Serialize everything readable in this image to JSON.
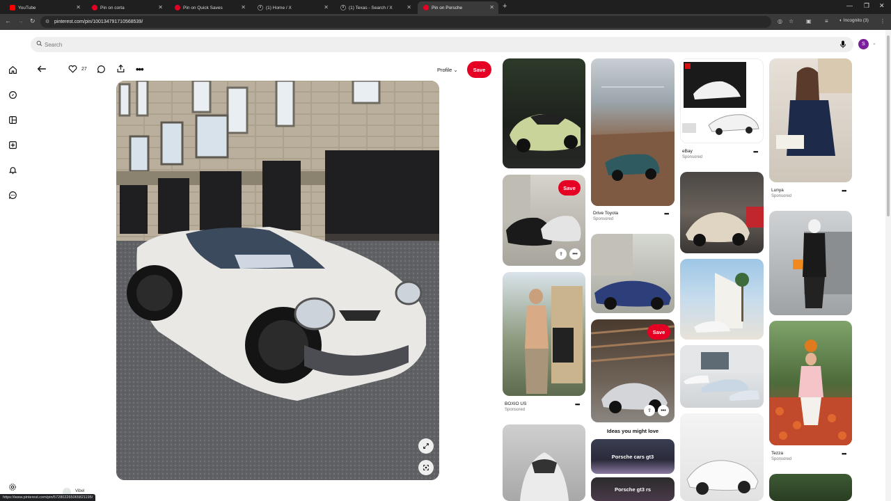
{
  "browser": {
    "tabs": [
      {
        "label": "YouTube",
        "favicon": "youtube-icon"
      },
      {
        "label": "Pin on corta",
        "favicon": "pinterest-icon"
      },
      {
        "label": "Pin on Quick Saves",
        "favicon": "pinterest-icon"
      },
      {
        "label": "(1) Home / X",
        "favicon": "x-icon"
      },
      {
        "label": "(1) Texas - Search / X",
        "favicon": "x-icon"
      },
      {
        "label": "Pin on Porsche",
        "favicon": "pinterest-icon",
        "active": true
      }
    ],
    "url": "pinterest.com/pin/100134791710568539/",
    "incognito_label": "Incognito (3)",
    "status_url": "https://www.pinterest.com/pin/572802265065821195/"
  },
  "app": {
    "brand_color": "#e60023",
    "search_placeholder": "Search",
    "avatar_letter": "S"
  },
  "pin": {
    "like_count": "27",
    "profile_label": "Profile",
    "save_label": "Save"
  },
  "feed": {
    "card_save_label": "Save",
    "cards": [
      {
        "title": "Drive Toyota",
        "subtitle": "Sponsored"
      },
      {
        "title": "eBay",
        "subtitle": "Sponsored"
      },
      {
        "title": "Lunya",
        "subtitle": "Sponsored"
      },
      {
        "title": "BOXIO US",
        "subtitle": "Sponsored"
      },
      {
        "title": "Tezza",
        "subtitle": "Sponsored"
      }
    ],
    "ideas_heading": "Ideas you might love",
    "ideas": [
      "Porsche cars gt3",
      "Porsche gt3 rs"
    ],
    "truncated_label": "Vibel"
  }
}
